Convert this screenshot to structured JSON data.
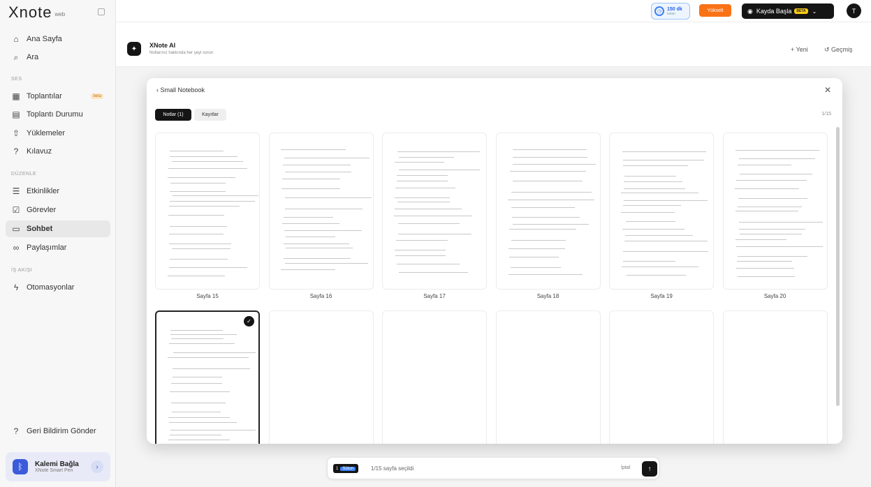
{
  "brand": {
    "name": "Xnote",
    "edition": "web"
  },
  "sidebar": {
    "items_top": [
      {
        "label": "Ana Sayfa",
        "icon": "home-icon"
      },
      {
        "label": "Ara",
        "icon": "search-icon"
      }
    ],
    "section1": "SES",
    "items_ses": [
      {
        "label": "Toplantılar",
        "icon": "calendar-icon",
        "badge": "beta"
      },
      {
        "label": "Toplantı Durumu",
        "icon": "clipboard-icon"
      },
      {
        "label": "Yüklemeler",
        "icon": "upload-icon"
      },
      {
        "label": "Kılavuz",
        "icon": "help-icon"
      }
    ],
    "section2": "DÜZENLE",
    "items_edit": [
      {
        "label": "Etkinlikler",
        "icon": "list-icon"
      },
      {
        "label": "Görevler",
        "icon": "checkbox-icon"
      },
      {
        "label": "Sohbet",
        "icon": "chat-icon",
        "active": true
      },
      {
        "label": "Paylaşımlar",
        "icon": "link-icon"
      }
    ],
    "section3": "İŞ AKIŞI",
    "items_flow": [
      {
        "label": "Otomasyonlar",
        "icon": "automation-icon"
      }
    ],
    "feedback": "Geri Bildirim Gönder",
    "pen": {
      "title": "Kalemi Bağla",
      "subtitle": "XNote Smart Pen"
    }
  },
  "topbar": {
    "credit_value": "150 dk",
    "credit_sub": "kalan",
    "upgrade": "Yükselt",
    "record": "Kayda Başla",
    "record_badge": "BETA",
    "avatar": "T"
  },
  "ai_header": {
    "title": "XNote AI",
    "subtitle": "Notlarınız hakkında her şeyi sorun",
    "new": "+ Yeni",
    "history": "Geçmiş"
  },
  "modal": {
    "title": "Small Notebook",
    "tabs": [
      "Notlar (1)",
      "Kayıtlar"
    ],
    "count": "1/15",
    "pages": [
      {
        "label": "Sayfa 15"
      },
      {
        "label": "Sayfa 16"
      },
      {
        "label": "Sayfa 17"
      },
      {
        "label": "Sayfa 18"
      },
      {
        "label": "Sayfa 19"
      },
      {
        "label": "Sayfa 20"
      },
      {
        "label": "",
        "selected": true
      },
      {
        "label": ""
      },
      {
        "label": ""
      },
      {
        "label": ""
      },
      {
        "label": ""
      },
      {
        "label": ""
      }
    ]
  },
  "bottom": {
    "chip_a": "1",
    "chip_b": "Sütun",
    "text": "1/15 sayfa seçildi",
    "cancel": "İptal"
  }
}
